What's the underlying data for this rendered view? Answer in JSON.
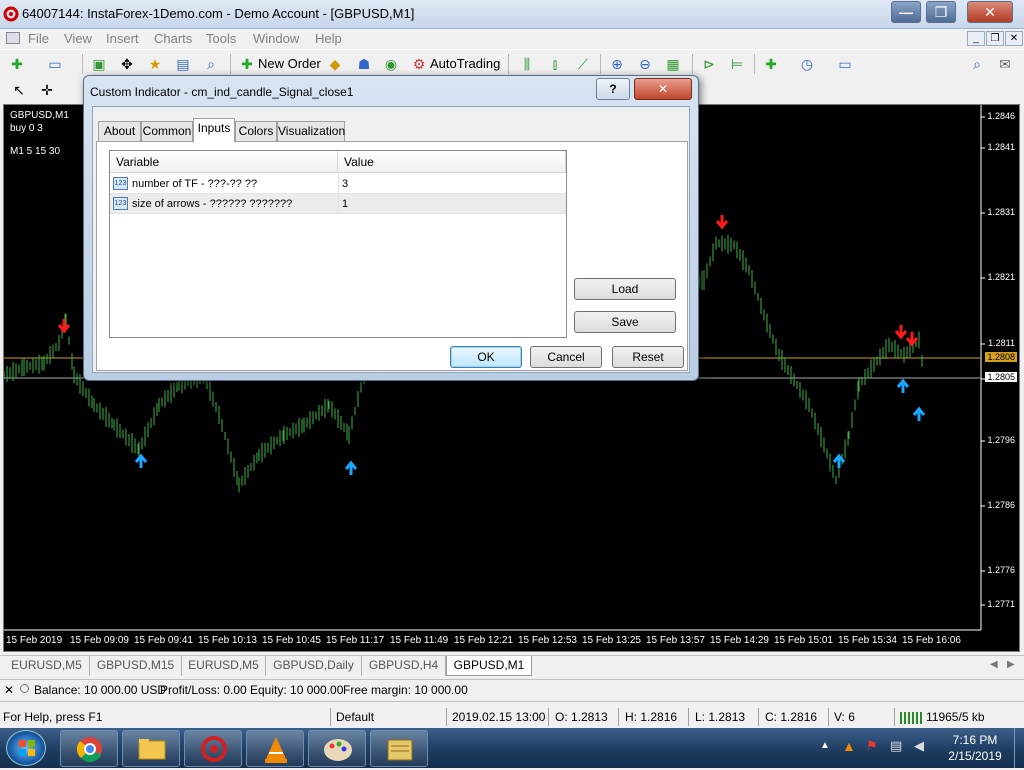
{
  "window": {
    "title": "64007144: InstaForex-1Demo.com - Demo Account - [GBPUSD,M1]",
    "minimize_glyph": "—",
    "maximize_glyph": "❐",
    "close_glyph": "✕"
  },
  "menu": [
    "File",
    "View",
    "Insert",
    "Charts",
    "Tools",
    "Window",
    "Help"
  ],
  "toolbar": {
    "new_order": "New Order",
    "autotrading": "AutoTrading"
  },
  "chart": {
    "symbol_label": "GBPUSD,M1",
    "line2": "buy 0 3",
    "line3": "M1 5 15 30",
    "price_labels": [
      "1.2846",
      "1.2841",
      "1.2831",
      "1.2821",
      "1.2811",
      "1.2806",
      "1.2796",
      "1.2786",
      "1.2776",
      "1.2771"
    ],
    "current_price_1": "1.2808",
    "current_price_2": "1.2805",
    "time_labels": [
      "15 Feb 2019",
      "15 Feb 09:09",
      "15 Feb 09:41",
      "15 Feb 10:13",
      "15 Feb 10:45",
      "15 Feb 11:17",
      "15 Feb 11:49",
      "15 Feb 12:21",
      "15 Feb 12:53",
      "15 Feb 13:25",
      "15 Feb 13:57",
      "15 Feb 14:29",
      "15 Feb 15:01",
      "15 Feb 15:34",
      "15 Feb 16:06"
    ],
    "bar_color": "#3cb043",
    "sell_arrow_color": "#ff1a1a",
    "buy_arrow_color": "#19a8ff",
    "level_color": "#d4a017"
  },
  "tabs": [
    "EURUSD,M5",
    "GBPUSD,M15",
    "EURUSD,M5",
    "GBPUSD,Daily",
    "GBPUSD,H4",
    "GBPUSD,M1"
  ],
  "terminal": {
    "balance": "Balance: 10 000.00 USD",
    "profit": "Profit/Loss: 0.00",
    "equity": "Equity: 10 000.00",
    "free_margin": "Free margin: 10 000.00"
  },
  "status": {
    "help": "For Help, press F1",
    "profile": "Default",
    "datetime": "2019.02.15 13:00",
    "open": "O: 1.2813",
    "high": "H: 1.2816",
    "low": "L: 1.2813",
    "close": "C: 1.2816",
    "volume": "V: 6",
    "traffic": "11965/5 kb"
  },
  "dialog": {
    "title": "Custom Indicator - cm_ind_candle_Signal_close1",
    "help_glyph": "?",
    "close_glyph": "✕",
    "tabs": [
      "About",
      "Common",
      "Inputs",
      "Colors",
      "Visualization"
    ],
    "active_tab": "Inputs",
    "grid_headers": [
      "Variable",
      "Value"
    ],
    "rows": [
      {
        "icon": "123",
        "variable": "number of TF - ???-?? ??",
        "value": "3"
      },
      {
        "icon": "123",
        "variable": "size of arrows - ?????? ???????",
        "value": "1"
      }
    ],
    "load": "Load",
    "save": "Save",
    "ok": "OK",
    "cancel": "Cancel",
    "reset": "Reset"
  },
  "taskbar": {
    "time": "7:16 PM",
    "date": "2/15/2019"
  }
}
